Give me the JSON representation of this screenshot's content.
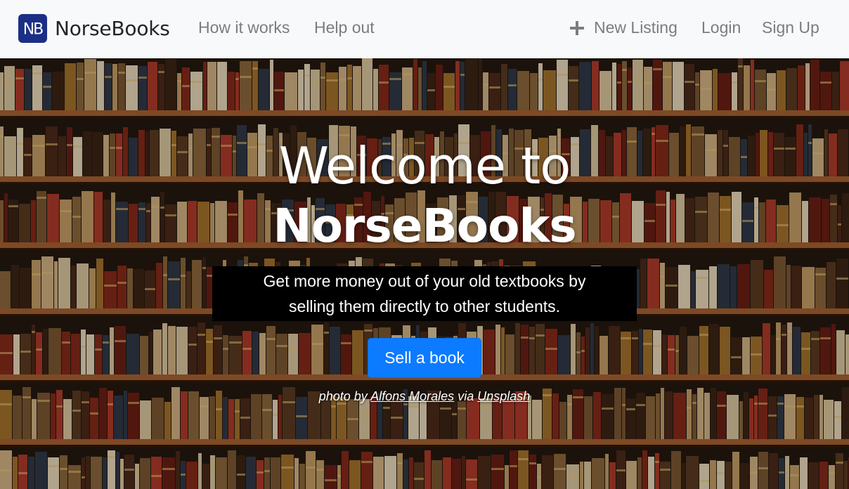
{
  "navbar": {
    "brand_logo_text": "NB",
    "brand_name": "NorseBooks",
    "links": {
      "how_it_works": "How it works",
      "help_out": "Help out",
      "new_listing": "New Listing",
      "login": "Login",
      "sign_up": "Sign Up"
    },
    "icons": {
      "new_listing": "plus-icon"
    }
  },
  "hero": {
    "title_line1": "Welcome to",
    "title_line2": "NorseBooks",
    "tagline_line1": "Get more money out of your old textbooks by",
    "tagline_line2": "selling them directly to other students.",
    "cta_label": "Sell a book",
    "credit": {
      "prefix": "photo by",
      "photographer": "Alfons Morales",
      "middle": "via",
      "source": "Unsplash"
    },
    "background_image": "bookshelf library photo"
  },
  "colors": {
    "navbar_bg": "#f8f9fa",
    "brand_logo": "#1b2f86",
    "nav_link": "#7a7d80",
    "cta_button": "#0d7bff",
    "tagline_bg": "#000000"
  }
}
